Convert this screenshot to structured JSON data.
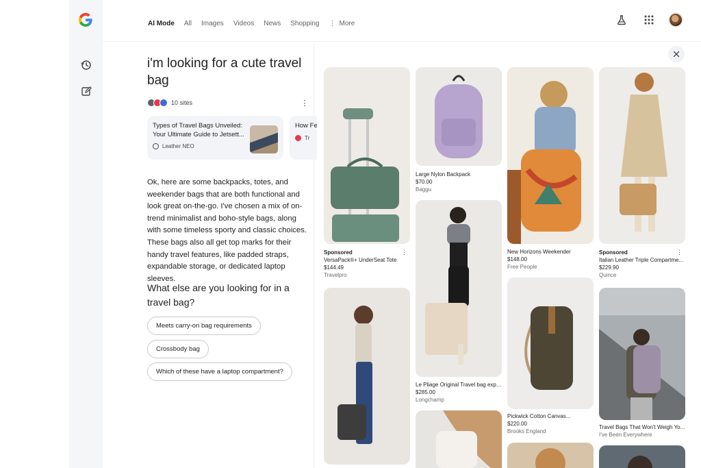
{
  "nav": {
    "tabs": [
      "AI Mode",
      "All",
      "Images",
      "Videos",
      "News",
      "Shopping",
      "More"
    ]
  },
  "chat": {
    "query": "i'm looking for a cute travel bag",
    "sites_count": "10 sites",
    "source_card": {
      "title": "Types of Travel Bags Unveiled: Your Ultimate Guide to Jetsett...",
      "site": "Leather NEO"
    },
    "source_card2": {
      "title": "How Feat",
      "site": "Tr"
    },
    "answer": "Ok, here are some backpacks, totes, and weekender bags that are both functional and look great on-the-go. I've chosen a mix of on-trend minimalist and boho-style bags, along with some timeless sporty and classic choices. These bags also all get top marks for their handy travel features, like padded straps, expandable storage, or dedicated laptop sleeves.",
    "followup_question": "What else are you looking for in a travel bag?",
    "chips": [
      "Meets carry-on bag requirements",
      "Crossbody bag",
      "Which of these have a laptop compartment?"
    ]
  },
  "products": [
    {
      "sponsored": "Sponsored",
      "title": "VersaPack®+ UnderSeat Tote",
      "price": "$144.49",
      "store": "Travelpro"
    },
    {
      "sponsored": "",
      "title": "Large Nylon Backpack",
      "price": "$70.00",
      "store": "Baggu"
    },
    {
      "sponsored": "",
      "title": "New Horizons Weekender",
      "price": "$148.00",
      "store": "Free People"
    },
    {
      "sponsored": "Sponsored",
      "title": "Italian Leather Triple Compartme...",
      "price": "$229.90",
      "store": "Quince"
    },
    {
      "sponsored": "",
      "title": "Le Pliage Original Travel bag expa...",
      "price": "$285.00",
      "store": "Longchamp"
    },
    {
      "sponsored": "",
      "title": "Pickwick Cotton Canvas...",
      "price": "$220.00",
      "store": "Brooks England"
    },
    {
      "sponsored": "",
      "title": "Travel Bags That Won't Weigh Yo...",
      "price": "",
      "store": "I've Been Everywhere"
    }
  ],
  "colors": {
    "rail_bg": "#f5f6f8",
    "card_bg": "#f2f4f7",
    "chip_border": "#c7c9cc",
    "google_blue": "#4285F4",
    "google_red": "#EA4335",
    "google_yellow": "#FBBC05",
    "google_green": "#34A853"
  },
  "icons": [
    "google-logo",
    "history-icon",
    "new-chat-icon",
    "labs-flask-icon",
    "apps-grid-icon",
    "avatar",
    "more-vert-icon",
    "close-icon"
  ]
}
